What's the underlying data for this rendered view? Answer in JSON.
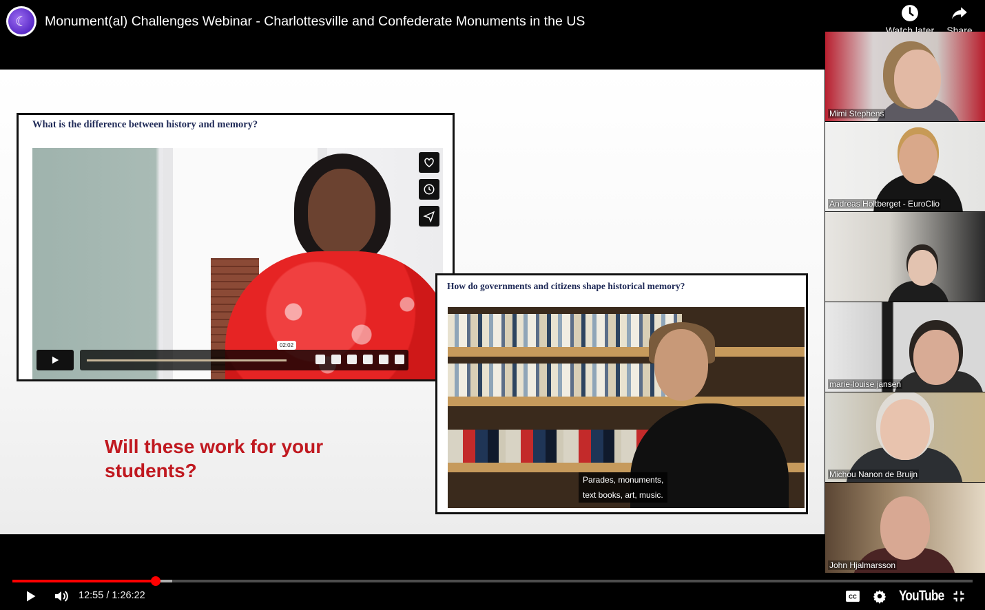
{
  "header": {
    "title": "Monument(al) Challenges Webinar - Charlottesville and Confederate Monuments in the US",
    "watch_later_label": "Watch later",
    "share_label": "Share"
  },
  "slide": {
    "panel1_question": "What is the difference between history and memory?",
    "panel1_time_bubble": "02:02",
    "panel2_question": "How do governments and citizens shape historical memory?",
    "panel2_subtitle_line1": "Parades, monuments,",
    "panel2_subtitle_line2": "text books, art, music.",
    "question_line1": "Will these work for your",
    "question_line2": "students?"
  },
  "participants": [
    {
      "name": "Mimi Stephens"
    },
    {
      "name": "Andreas Holtberget - EuroClio"
    },
    {
      "name": ""
    },
    {
      "name": "marie-louise jansen"
    },
    {
      "name": "Michou Nanon de Bruijn"
    },
    {
      "name": "John Hjalmarsson"
    }
  ],
  "player": {
    "time_display": "12:55 / 1:26:22",
    "progress_fraction": 0.149,
    "logo_text": "YouTube",
    "accent_color": "#ff0000"
  },
  "icons": {
    "play": "play-icon",
    "volume": "volume-icon",
    "captions": "captions-icon",
    "settings": "gear-icon",
    "exit_fullscreen": "exit-fullscreen-icon",
    "watch_later": "clock-icon",
    "share": "share-arrow-icon"
  }
}
